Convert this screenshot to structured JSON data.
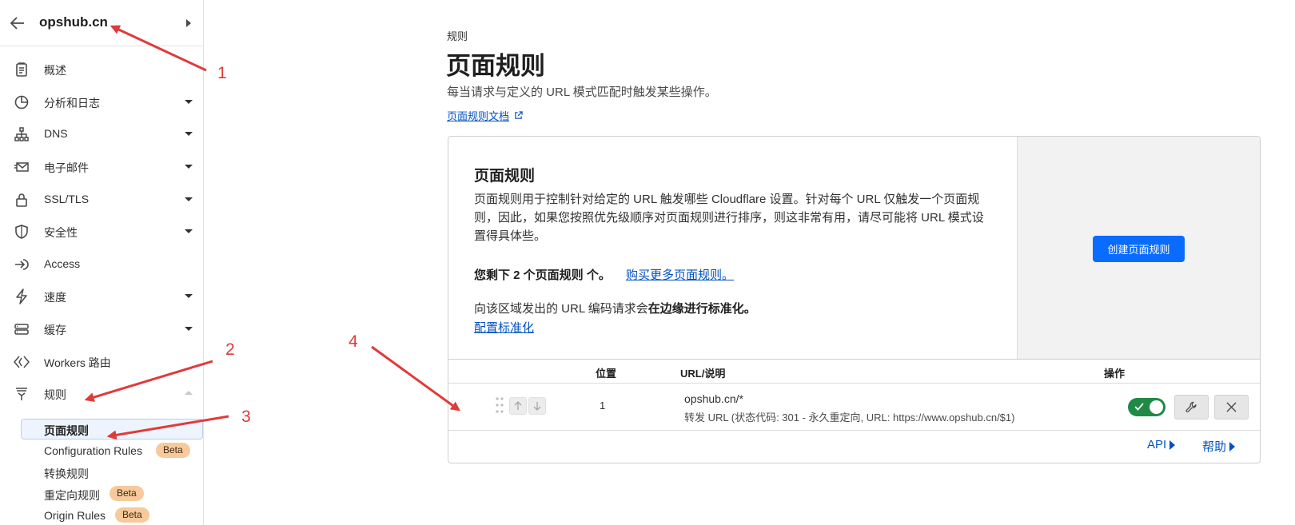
{
  "sidebar": {
    "zone_name": "opshub.cn",
    "items": [
      {
        "label": "概述",
        "icon": "clipboard-icon"
      },
      {
        "label": "分析和日志",
        "icon": "chart-pie-icon"
      },
      {
        "label": "DNS",
        "icon": "network-icon"
      },
      {
        "label": "电子邮件",
        "icon": "email-icon"
      },
      {
        "label": "SSL/TLS",
        "icon": "lock-icon"
      },
      {
        "label": "安全性",
        "icon": "shield-icon"
      },
      {
        "label": "Access",
        "icon": "access-icon"
      },
      {
        "label": "速度",
        "icon": "lightning-icon"
      },
      {
        "label": "缓存",
        "icon": "server-icon"
      },
      {
        "label": "Workers 路由",
        "icon": "workers-icon"
      },
      {
        "label": "规则",
        "icon": "rules-icon"
      }
    ],
    "sub_items": [
      {
        "label": "页面规则"
      },
      {
        "label": "Configuration Rules",
        "badge": "Beta"
      },
      {
        "label": "转换规则"
      },
      {
        "label": "重定向规则",
        "badge": "Beta"
      },
      {
        "label": "Origin Rules",
        "badge": "Beta"
      }
    ]
  },
  "header": {
    "breadcrumb": "规则",
    "title": "页面规则",
    "description": "每当请求与定义的 URL 模式匹配时触发某些操作。",
    "docs_link": "页面规则文档"
  },
  "card": {
    "title": "页面规则",
    "text": "页面规则用于控制针对给定的 URL 触发哪些 Cloudflare 设置。针对每个 URL 仅触发一个页面规则，因此，如果您按照优先级顺序对页面规则进行排序，则这非常有用，请尽可能将 URL 模式设置得具体些。",
    "remaining": "您剩下 2 个页面规则 个。",
    "buy_link": "购买更多页面规则。",
    "normalize_text": "向该区域发出的 URL 编码请求会",
    "normalize_strong": "在边缘进行标准化。",
    "normalize_link": "配置标准化",
    "create_button": "创建页面规则"
  },
  "table": {
    "columns": [
      "位置",
      "URL/说明",
      "操作"
    ],
    "rows": [
      {
        "position": "1",
        "url": "opshub.cn/*",
        "description": "转发 URL (状态代码: 301 - 永久重定向, URL: https://www.opshub.cn/$1)",
        "enabled": true
      }
    ]
  },
  "footer": {
    "api_link": "API",
    "help_link": "帮助"
  },
  "annotations": [
    "1",
    "2",
    "3",
    "4"
  ],
  "colors": {
    "accent": "#0a6cff",
    "link": "#0051c3",
    "toggle_on": "#1e8a45",
    "annotation": "#e03a3a",
    "badge": "#f7c99b"
  }
}
